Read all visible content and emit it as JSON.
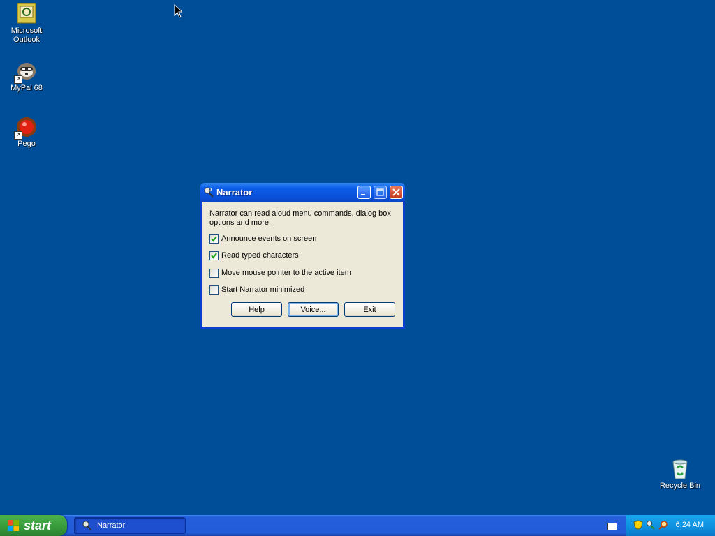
{
  "desktop": {
    "icons": [
      {
        "label": "Microsoft\nOutlook"
      },
      {
        "label": "MyPal 68"
      },
      {
        "label": "Pego"
      },
      {
        "label": "Recycle Bin"
      }
    ]
  },
  "window": {
    "title": "Narrator",
    "description": "Narrator can read aloud menu commands, dialog box options and more.",
    "options": [
      {
        "label": "Announce events on screen",
        "checked": true
      },
      {
        "label": "Read typed characters",
        "checked": true
      },
      {
        "label": "Move mouse pointer to the active item",
        "checked": false
      },
      {
        "label": "Start Narrator minimized",
        "checked": false
      }
    ],
    "buttons": {
      "help": "Help",
      "voice": "Voice...",
      "exit": "Exit"
    }
  },
  "taskbar": {
    "start_label": "start",
    "task_label": "Narrator",
    "clock": "6:24 AM"
  },
  "colors": {
    "desktop": "#004e98",
    "taskbar": "#245edc",
    "start": "#36993a"
  }
}
